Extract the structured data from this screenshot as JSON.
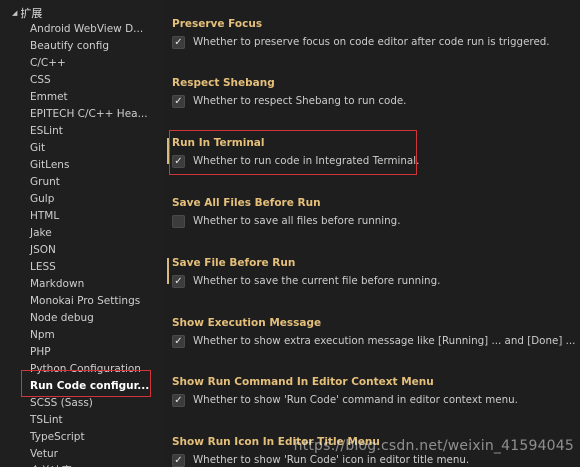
{
  "sidebar": {
    "section_label": "扩展",
    "items": [
      "Android WebView D...",
      "Beautify config",
      "C/C++",
      "CSS",
      "Emmet",
      "EPITECH C/C++ Hea...",
      "ESLint",
      "Git",
      "GitLens",
      "Grunt",
      "Gulp",
      "HTML",
      "Jake",
      "JSON",
      "LESS",
      "Markdown",
      "Monokai Pro Settings",
      "Node debug",
      "Npm",
      "PHP",
      "Python Configuration",
      "Run Code configur...",
      "SCSS (Sass)",
      "TSLint",
      "TypeScript",
      "Vetur",
      "合并冲突"
    ],
    "selected_index": 21
  },
  "settings": [
    {
      "title": "Preserve Focus",
      "description": "Whether to preserve focus on code editor after code run is triggered.",
      "checked": true,
      "modified": false
    },
    {
      "title": "Respect Shebang",
      "description": "Whether to respect Shebang to run code.",
      "checked": true,
      "modified": false
    },
    {
      "title": "Run In Terminal",
      "description": "Whether to run code in Integrated Terminal.",
      "checked": true,
      "modified": true
    },
    {
      "title": "Save All Files Before Run",
      "description": "Whether to save all files before running.",
      "checked": false,
      "modified": false
    },
    {
      "title": "Save File Before Run",
      "description": "Whether to save the current file before running.",
      "checked": true,
      "modified": true
    },
    {
      "title": "Show Execution Message",
      "description": "Whether to show extra execution message like [Running] ... and [Done] ...",
      "checked": true,
      "modified": false
    },
    {
      "title": "Show Run Command In Editor Context Menu",
      "description": "Whether to show 'Run Code' command in editor context menu.",
      "checked": true,
      "modified": false
    },
    {
      "title": "Show Run Icon In Editor Title Menu",
      "description": "Whether to show 'Run Code' icon in editor title menu.",
      "checked": true,
      "modified": false
    }
  ],
  "check_glyph": "✓",
  "watermark": "https://blog.csdn.net/weixin_41594045",
  "colors": {
    "accent_title": "#e5c07b",
    "highlight_box": "#d13438",
    "modified_bar": "#d7ba7d"
  }
}
